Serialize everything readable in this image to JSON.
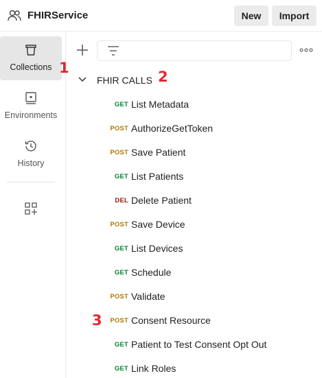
{
  "header": {
    "workspace_icon": "users-icon",
    "title": "FHIRService",
    "new_label": "New",
    "import_label": "Import"
  },
  "sidebar": {
    "items": [
      {
        "label": "Collections",
        "icon": "collections-trash-can-icon",
        "active": true
      },
      {
        "label": "Environments",
        "icon": "environments-icon",
        "active": false
      },
      {
        "label": "History",
        "icon": "history-icon",
        "active": false
      }
    ],
    "apps_icon": "add-apps-icon"
  },
  "annotations": {
    "one": "1",
    "two": "2",
    "three": "3"
  },
  "toolbar": {
    "add_icon": "plus-icon",
    "filter_icon": "filter-icon",
    "filter_value": "",
    "more_icon": "ellipsis-icon"
  },
  "collection": {
    "name": "FHIR CALLS",
    "expanded": true,
    "requests": [
      {
        "method": "GET",
        "name": "List Metadata"
      },
      {
        "method": "POST",
        "name": "AuthorizeGetToken"
      },
      {
        "method": "POST",
        "name": "Save Patient"
      },
      {
        "method": "GET",
        "name": "List Patients"
      },
      {
        "method": "DEL",
        "name": "Delete Patient"
      },
      {
        "method": "POST",
        "name": "Save Device"
      },
      {
        "method": "GET",
        "name": "List Devices"
      },
      {
        "method": "GET",
        "name": "Schedule"
      },
      {
        "method": "POST",
        "name": "Validate"
      },
      {
        "method": "POST",
        "name": "Consent Resource"
      },
      {
        "method": "GET",
        "name": "Patient to Test Consent Opt Out"
      },
      {
        "method": "GET",
        "name": "Link Roles"
      }
    ]
  },
  "colors": {
    "get": "#007f31",
    "post": "#ad7a03",
    "del": "#8e1a10",
    "annotation": "#e0282e"
  }
}
